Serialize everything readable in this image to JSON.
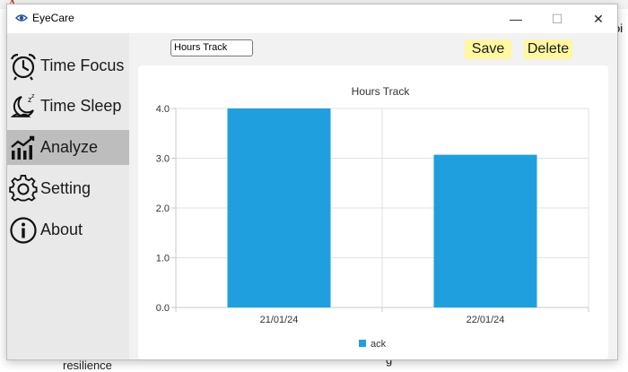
{
  "background_window": {
    "top_left_letter": "A",
    "right_fragment": "oi",
    "bottom_fragment": "resilience",
    "bottom_fragment_2": "g"
  },
  "app": {
    "title": "EyeCare",
    "window_controls": {
      "minimize": "—",
      "maximize": "☐",
      "close": "✕"
    }
  },
  "sidebar": {
    "items": [
      {
        "label": "Time Focus",
        "icon": "alarm-clock-icon",
        "active": false
      },
      {
        "label": "Time Sleep",
        "icon": "sleep-moon-icon",
        "active": false
      },
      {
        "label": "Analyze",
        "icon": "chart-trend-icon",
        "active": true
      },
      {
        "label": "Setting",
        "icon": "gear-icon",
        "active": false
      },
      {
        "label": "About",
        "icon": "info-icon",
        "active": false
      }
    ],
    "active_color": "#bdbdbd",
    "background_color": "#e9e9e9"
  },
  "toolbar": {
    "title_value": "Hours Track",
    "save_label": "Save",
    "delete_label": "Delete",
    "button_color": "#fff7a1"
  },
  "chart_data": {
    "type": "bar",
    "title": "Hours Track",
    "categories": [
      "21/01/24",
      "22/01/24"
    ],
    "series": [
      {
        "name": "ack",
        "values": [
          4.0,
          3.07
        ],
        "color": "#209fdf"
      }
    ],
    "ylim": [
      0,
      4.0
    ],
    "yticks": [
      "0.0",
      "1.0",
      "2.0",
      "3.0",
      "4.0"
    ],
    "xlabel": "",
    "ylabel": "",
    "grid": true,
    "legend": "bottom-center"
  }
}
